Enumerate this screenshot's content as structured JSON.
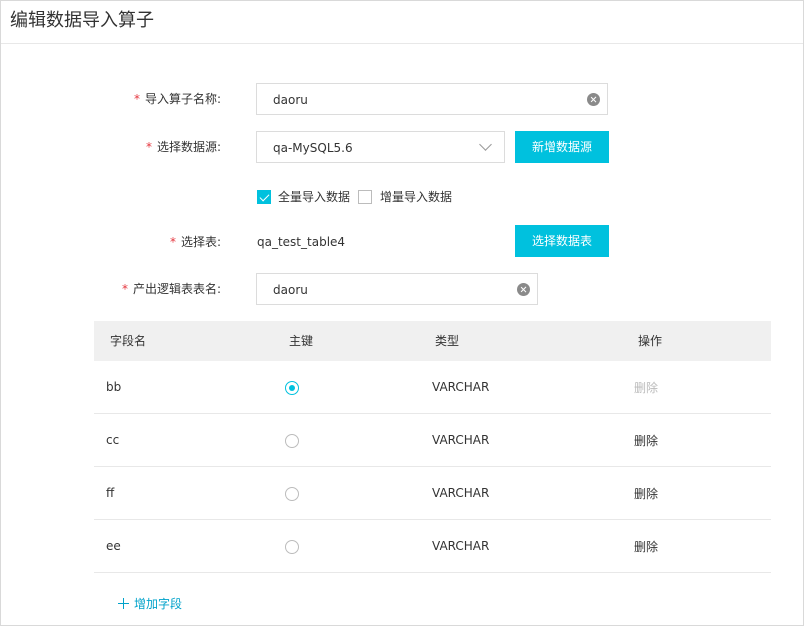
{
  "header": {
    "title": "编辑数据导入算子"
  },
  "form": {
    "operator_name": {
      "required": "*",
      "label": "导入算子名称:",
      "value": "daoru"
    },
    "datasource": {
      "required": "*",
      "label": "选择数据源:",
      "value": "qa-MySQL5.6",
      "new_button": "新增数据源"
    },
    "import_mode": {
      "full": {
        "label": "全量导入数据",
        "checked": true
      },
      "incremental": {
        "label": "增量导入数据",
        "checked": false
      }
    },
    "table": {
      "required": "*",
      "label": "选择表:",
      "value": "qa_test_table4",
      "select_button": "选择数据表"
    },
    "output_table": {
      "required": "*",
      "label": "产出逻辑表表名:",
      "value": "daoru"
    }
  },
  "fields_table": {
    "headers": {
      "name": "字段名",
      "primary_key": "主键",
      "type": "类型",
      "action": "操作"
    },
    "rows": [
      {
        "name": "bb",
        "primary_key": true,
        "type": "VARCHAR",
        "action": "删除",
        "action_disabled": true
      },
      {
        "name": "cc",
        "primary_key": false,
        "type": "VARCHAR",
        "action": "删除",
        "action_disabled": false
      },
      {
        "name": "ff",
        "primary_key": false,
        "type": "VARCHAR",
        "action": "删除",
        "action_disabled": false
      },
      {
        "name": "ee",
        "primary_key": false,
        "type": "VARCHAR",
        "action": "删除",
        "action_disabled": false
      }
    ],
    "add_field": "增加字段"
  },
  "colors": {
    "accent": "#00c1de",
    "link": "#00a2ca",
    "required": "#e5373f",
    "disabled": "#bbbbbb"
  }
}
